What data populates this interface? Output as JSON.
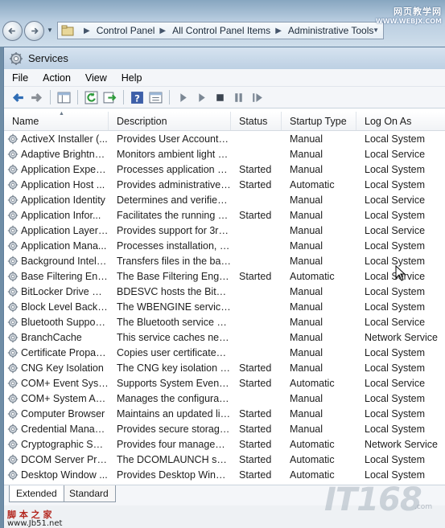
{
  "explorer": {
    "breadcrumb": [
      "Control Panel",
      "All Control Panel Items",
      "Administrative Tools"
    ],
    "watermark_cn": "网页教学网",
    "watermark_url": "WWW.WEBJX.COM"
  },
  "window": {
    "title": "Services",
    "menu": [
      "File",
      "Action",
      "View",
      "Help"
    ],
    "toolbar_icons": [
      "back-icon",
      "forward-icon",
      "show-hide-tree-icon",
      "refresh-icon",
      "export-list-icon",
      "help-icon",
      "properties-icon",
      "start-service-icon",
      "start-service-alt-icon",
      "stop-service-icon",
      "pause-service-icon",
      "restart-service-icon"
    ]
  },
  "columns": {
    "name": "Name",
    "description": "Description",
    "status": "Status",
    "startup_type": "Startup Type",
    "log_on_as": "Log On As"
  },
  "rows": [
    {
      "name": "ActiveX Installer (...",
      "description": "Provides User Account C...",
      "status": "",
      "startup": "Manual",
      "logon": "Local System"
    },
    {
      "name": "Adaptive Brightness",
      "description": "Monitors ambient light s...",
      "status": "",
      "startup": "Manual",
      "logon": "Local Service"
    },
    {
      "name": "Application Experi...",
      "description": "Processes application co...",
      "status": "Started",
      "startup": "Manual",
      "logon": "Local System"
    },
    {
      "name": "Application Host ...",
      "description": "Provides administrative s...",
      "status": "Started",
      "startup": "Automatic",
      "logon": "Local System"
    },
    {
      "name": "Application Identity",
      "description": "Determines and verifies t...",
      "status": "",
      "startup": "Manual",
      "logon": "Local Service"
    },
    {
      "name": "Application Infor...",
      "description": "Facilitates the running of...",
      "status": "Started",
      "startup": "Manual",
      "logon": "Local System"
    },
    {
      "name": "Application Layer ...",
      "description": "Provides support for 3rd ...",
      "status": "",
      "startup": "Manual",
      "logon": "Local Service"
    },
    {
      "name": "Application Mana...",
      "description": "Processes installation, re...",
      "status": "",
      "startup": "Manual",
      "logon": "Local System"
    },
    {
      "name": "Background Intelli...",
      "description": "Transfers files in the bac...",
      "status": "",
      "startup": "Manual",
      "logon": "Local System"
    },
    {
      "name": "Base Filtering Engi...",
      "description": "The Base Filtering Engine...",
      "status": "Started",
      "startup": "Automatic",
      "logon": "Local Service"
    },
    {
      "name": "BitLocker Drive En...",
      "description": "BDESVC hosts the BitLoc...",
      "status": "",
      "startup": "Manual",
      "logon": "Local System"
    },
    {
      "name": "Block Level Backu...",
      "description": "The WBENGINE service is...",
      "status": "",
      "startup": "Manual",
      "logon": "Local System"
    },
    {
      "name": "Bluetooth Support...",
      "description": "The Bluetooth service su...",
      "status": "",
      "startup": "Manual",
      "logon": "Local Service"
    },
    {
      "name": "BranchCache",
      "description": "This service caches netw...",
      "status": "",
      "startup": "Manual",
      "logon": "Network Service"
    },
    {
      "name": "Certificate Propag...",
      "description": "Copies user certificates a...",
      "status": "",
      "startup": "Manual",
      "logon": "Local System"
    },
    {
      "name": "CNG Key Isolation",
      "description": "The CNG key isolation se...",
      "status": "Started",
      "startup": "Manual",
      "logon": "Local System"
    },
    {
      "name": "COM+ Event Syst...",
      "description": "Supports System Event N...",
      "status": "Started",
      "startup": "Automatic",
      "logon": "Local Service"
    },
    {
      "name": "COM+ System Ap...",
      "description": "Manages the configurati...",
      "status": "",
      "startup": "Manual",
      "logon": "Local System"
    },
    {
      "name": "Computer Browser",
      "description": "Maintains an updated lis...",
      "status": "Started",
      "startup": "Manual",
      "logon": "Local System"
    },
    {
      "name": "Credential Manager",
      "description": "Provides secure storage ...",
      "status": "Started",
      "startup": "Manual",
      "logon": "Local System"
    },
    {
      "name": "Cryptographic Ser...",
      "description": "Provides four managem...",
      "status": "Started",
      "startup": "Automatic",
      "logon": "Network Service"
    },
    {
      "name": "DCOM Server Pro...",
      "description": "The DCOMLAUNCH serv...",
      "status": "Started",
      "startup": "Automatic",
      "logon": "Local System"
    },
    {
      "name": "Desktop Window ...",
      "description": "Provides Desktop Windo...",
      "status": "Started",
      "startup": "Automatic",
      "logon": "Local System"
    }
  ],
  "tabs": {
    "extended": "Extended",
    "standard": "Standard"
  },
  "watermarks": {
    "jb51_cn": "脚 本 之 家",
    "jb51_url": "www.Jb51.net",
    "it168": "IT168",
    "it168_small": ".com"
  }
}
